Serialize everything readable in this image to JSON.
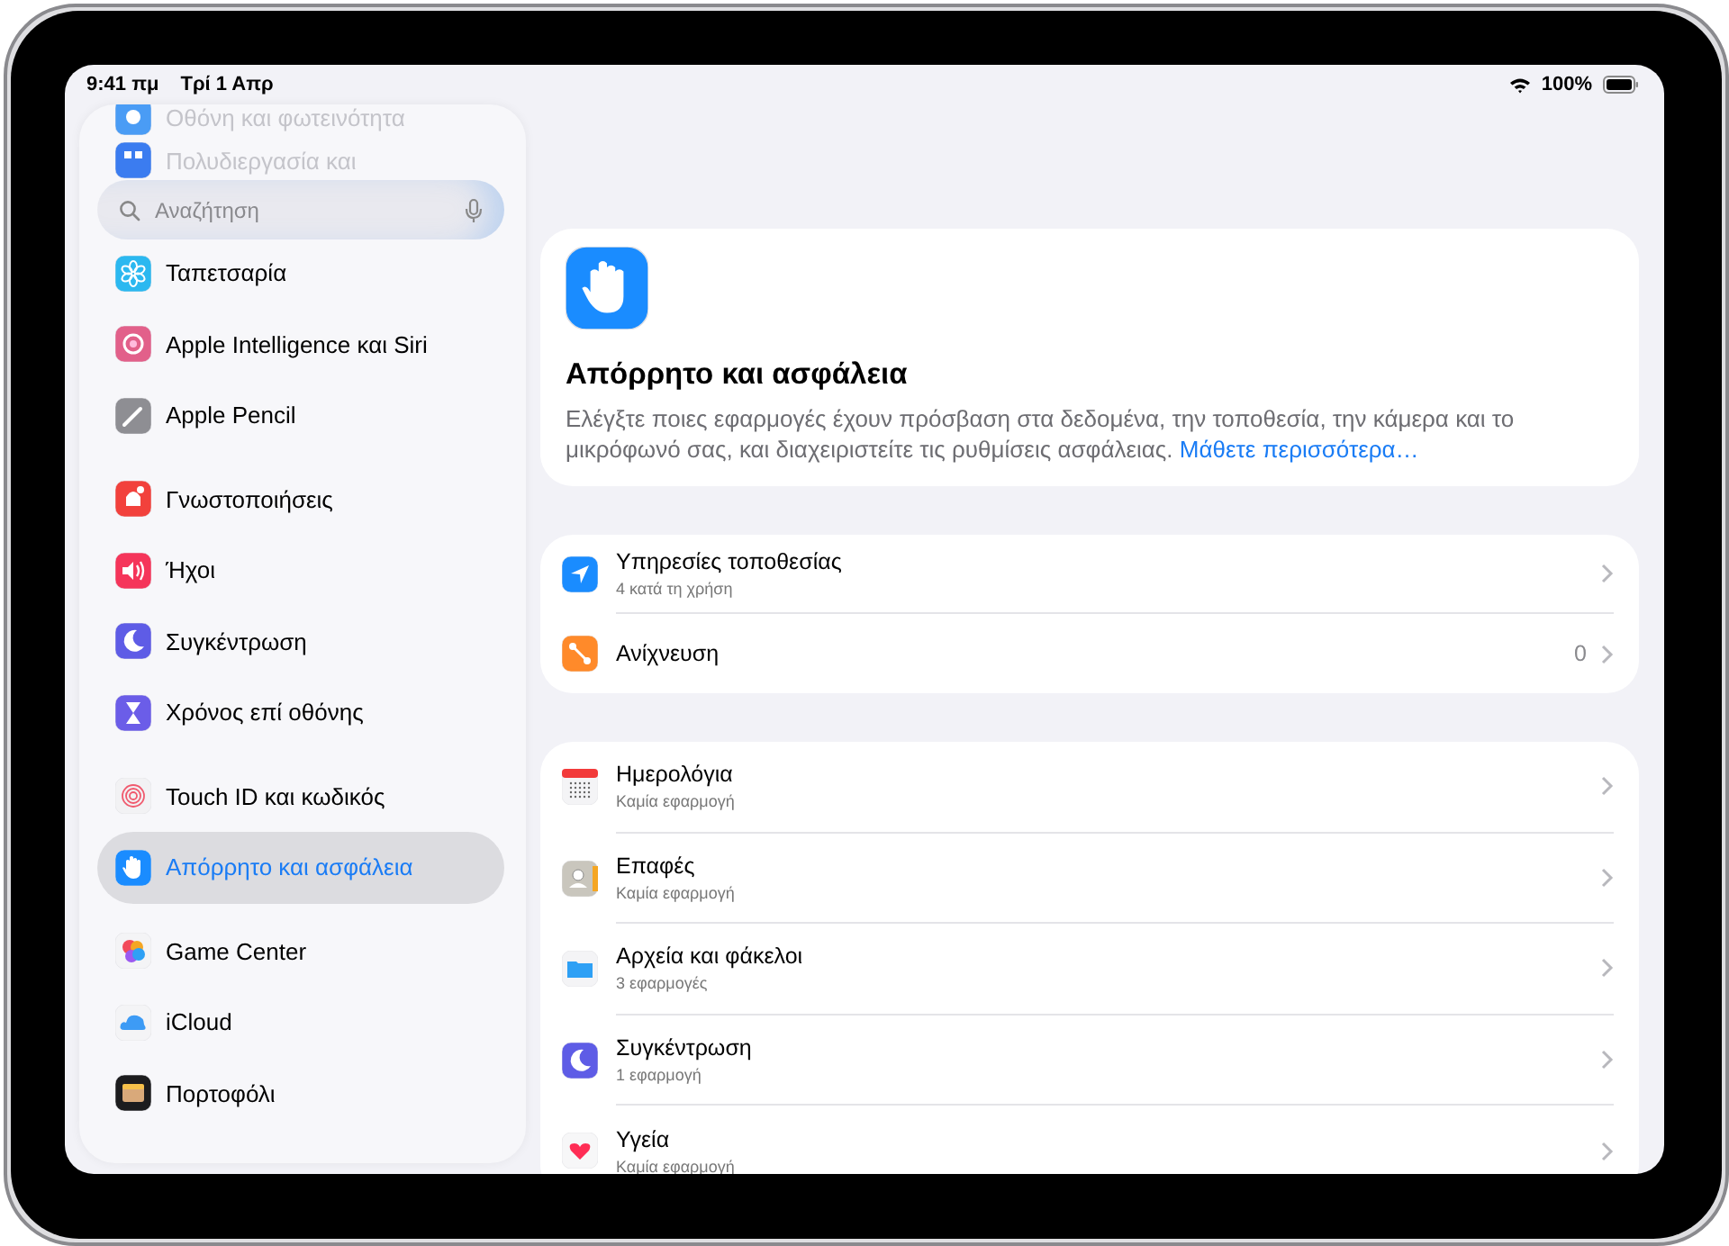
{
  "status_bar": {
    "time": "9:41 πμ",
    "date": "Τρί 1 Απρ",
    "battery": "100%"
  },
  "sidebar": {
    "search": {
      "placeholder": "Αναζήτηση"
    },
    "groups": [
      [
        {
          "label": "Οθόνη και φωτεινότητα",
          "color": "#4a9cf5",
          "dimmed": true,
          "selected": false
        },
        {
          "label": "Πολυδιεργασία και",
          "color": "#3b7cf0",
          "dimmed": true,
          "selected": false
        }
      ],
      [
        {
          "label": "Ταπετσαρία",
          "color": "#2bb8f0",
          "dimmed": false,
          "selected": false
        },
        {
          "label": "Apple Intelligence και Siri",
          "color": "#e2608a",
          "dimmed": false,
          "selected": false
        },
        {
          "label": "Apple Pencil",
          "color": "#8e8e93",
          "dimmed": false,
          "selected": false
        }
      ],
      [
        {
          "label": "Γνωστοποιήσεις",
          "color": "#f2413c",
          "dimmed": false,
          "selected": false
        },
        {
          "label": "Ήχοι",
          "color": "#f5355a",
          "dimmed": false,
          "selected": false
        },
        {
          "label": "Συγκέντρωση",
          "color": "#5e5ce6",
          "dimmed": false,
          "selected": false
        },
        {
          "label": "Χρόνος επί οθόνης",
          "color": "#6b5de8",
          "dimmed": false,
          "selected": false
        }
      ],
      [
        {
          "label": "Touch ID και κωδικός",
          "color": "#f2f2f4",
          "dimmed": false,
          "selected": false
        },
        {
          "label": "Απόρρητο και ασφάλεια",
          "color": "#1a8cff",
          "dimmed": false,
          "selected": true
        }
      ],
      [
        {
          "label": "Game Center",
          "color": "#f4f4f6",
          "dimmed": false,
          "selected": false
        },
        {
          "label": "iCloud",
          "color": "#f4f4f6",
          "dimmed": false,
          "selected": false
        },
        {
          "label": "Πορτοφόλι",
          "color": "#1c1c1e",
          "dimmed": false,
          "selected": false
        }
      ]
    ]
  },
  "header": {
    "title": "Απόρρητο και ασφάλεια",
    "description": "Ελέγξτε ποιες εφαρμογές έχουν πρόσβαση στα δεδομένα, την τοποθεσία, την κάμερα και το μικρόφωνό σας, και διαχειριστείτε τις ρυθμίσεις ασφάλειας.",
    "link": "Μάθετε περισσότερα…"
  },
  "sections": [
    [
      {
        "title": "Υπηρεσίες τοποθεσίας",
        "subtitle": "4 κατά τη χρήση",
        "color": "#1a8cff"
      },
      {
        "title": "Ανίχνευση",
        "value": "0",
        "color": "#ff8a2a"
      }
    ],
    [
      {
        "title": "Ημερολόγια",
        "subtitle": "Καμία εφαρμογή",
        "color": "#f4f4f6"
      },
      {
        "title": "Επαφές",
        "subtitle": "Καμία εφαρμογή",
        "color": "#c9c6bd"
      },
      {
        "title": "Αρχεία και φάκελοι",
        "subtitle": "3 εφαρμογές",
        "color": "#f4f4f6"
      },
      {
        "title": "Συγκέντρωση",
        "subtitle": "1 εφαρμογή",
        "color": "#5e5ce6"
      },
      {
        "title": "Υγεία",
        "subtitle": "Καμία εφαρμογή",
        "color": "#f7f7f8"
      }
    ]
  ]
}
